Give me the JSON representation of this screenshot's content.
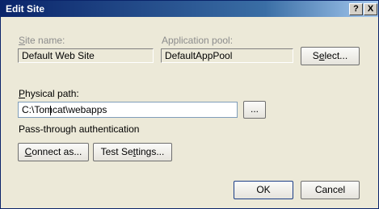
{
  "window": {
    "title": "Edit Site",
    "help_glyph": "?",
    "close_glyph": "X"
  },
  "site_name": {
    "label_access": "S",
    "label_rest": "ite name:",
    "value": "Default Web Site"
  },
  "app_pool": {
    "label": "Application pool:",
    "value": "DefaultAppPool"
  },
  "select_button": {
    "label_pre": "S",
    "label_access": "e",
    "label_post": "lect..."
  },
  "physical_path": {
    "label_access": "P",
    "label_rest": "hysical path:",
    "value": "C:\\Tomcat\\webapps",
    "browse_label": "..."
  },
  "auth": {
    "label": "Pass-through authentication"
  },
  "connect_button": {
    "label_access": "C",
    "label_rest": "onnect as..."
  },
  "test_settings_button": {
    "label_pre": "Test Se",
    "label_access": "t",
    "label_post": "tings..."
  },
  "ok_button": {
    "label": "OK"
  },
  "cancel_button": {
    "label": "Cancel"
  }
}
